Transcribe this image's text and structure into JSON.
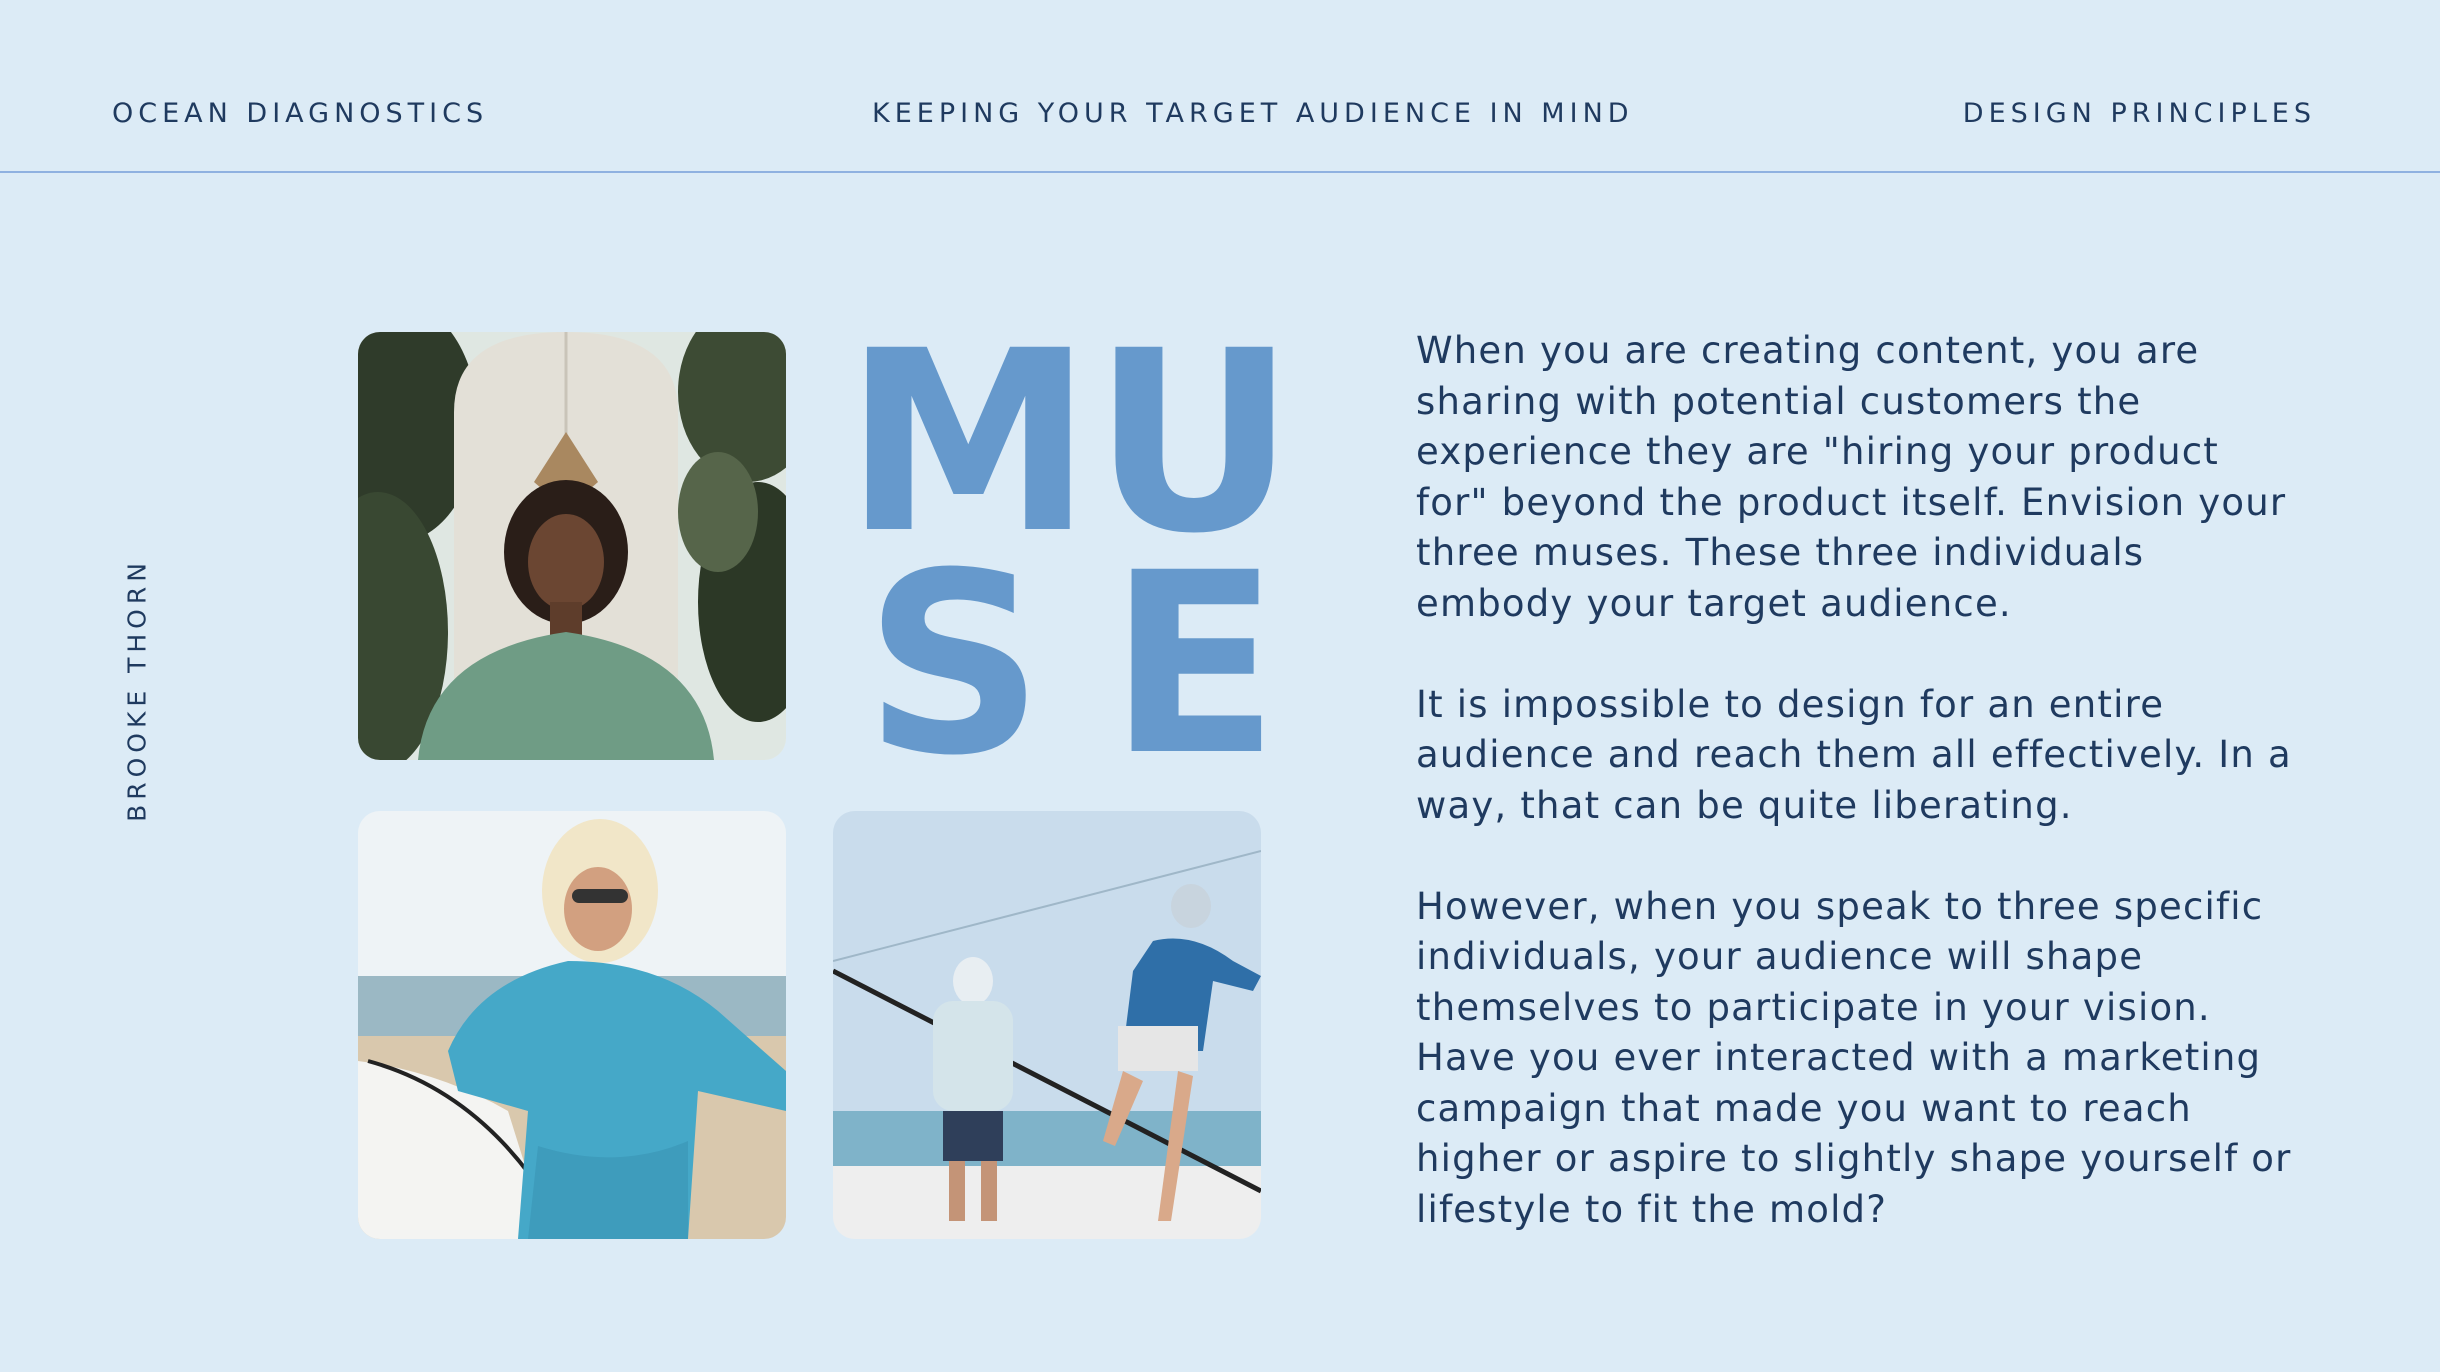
{
  "header": {
    "left": "OCEAN DIAGNOSTICS",
    "center": "KEEPING YOUR TARGET AUDIENCE IN MIND",
    "right": "DESIGN PRINCIPLES"
  },
  "sidebar": {
    "author": "BROOKE THORN"
  },
  "title": {
    "letters": [
      "M",
      "U",
      "S",
      "E"
    ]
  },
  "body": {
    "paragraphs": [
      "When you are creating content, you are sharing with potential customers the experience they are \"hiring your product for\" beyond the product itself. Envision your three muses. These three individuals embody your target audience.",
      "It is impossible to design for an entire audience and reach them all effectively. In a way, that can be quite liberating.",
      "However, when you speak to three specific individuals, your audience will shape themselves to participate in your vision. Have you ever interacted with a marketing campaign that made you want to reach higher or aspire to slightly shape yourself or lifestyle to fit the mold?"
    ]
  },
  "colors": {
    "background": "#dcebf6",
    "accent": "#6699cc",
    "text": "#1f3a5f",
    "rule": "#8fb1e0"
  }
}
